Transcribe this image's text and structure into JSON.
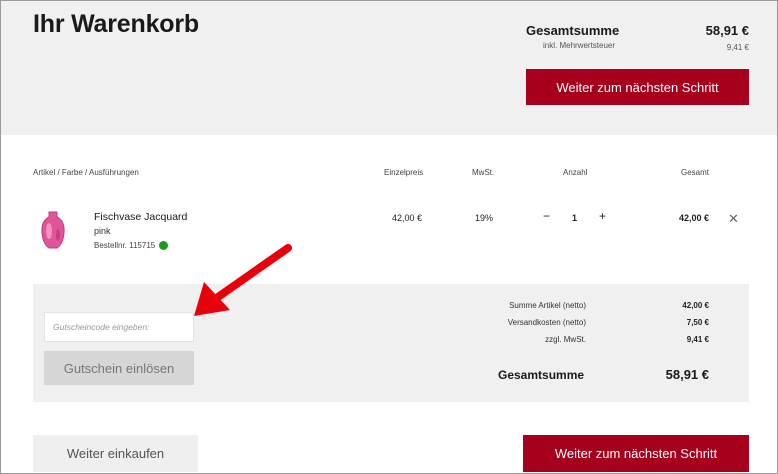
{
  "header": {
    "title": "Ihr Warenkorb",
    "total_label": "Gesamtsumme",
    "total_value": "58,91 €",
    "vat_label": "inkl. Mehrwertsteuer",
    "vat_value": "9,41 €",
    "next_button": "Weiter zum nächsten Schritt"
  },
  "columns": {
    "article": "Artikel / Farbe / Ausführungen",
    "unit_price": "Einzelpreis",
    "vat": "MwSt.",
    "quantity": "Anzahl",
    "total": "Gesamt"
  },
  "item": {
    "name": "Fischvase Jacquard",
    "color": "pink",
    "order_number": "Bestellnr. 115715",
    "unit_price": "42,00 €",
    "vat_rate": "19%",
    "qty_minus": "−",
    "quantity": "1",
    "qty_plus": "+",
    "line_total": "42,00 €",
    "remove_icon": "✕",
    "stock_status_color": "#1c9a1c",
    "image_color": "#e0559a"
  },
  "coupon": {
    "placeholder": "Gutscheincode eingeben:",
    "value": "",
    "button_label": "Gutschein einlösen"
  },
  "summary": {
    "rows": [
      {
        "label": "Summe Artikel (netto)",
        "value": "42,00 €"
      },
      {
        "label": "Versandkosten (netto)",
        "value": "7,50 €"
      },
      {
        "label": "zzgl. MwSt.",
        "value": "9,41 €"
      }
    ],
    "grand_total_label": "Gesamtsumme",
    "grand_total_value": "58,91 €"
  },
  "footer": {
    "continue_shopping": "Weiter einkaufen",
    "next_button": "Weiter zum nächsten Schritt"
  },
  "colors": {
    "brand_red": "#a6001c",
    "annotation_arrow": "#e8000b",
    "panel_bg": "#f0f0f0"
  },
  "icons": {
    "remove": "close-icon",
    "stock": "in-stock-dot-icon",
    "annotation": "arrow-pointer-icon"
  }
}
